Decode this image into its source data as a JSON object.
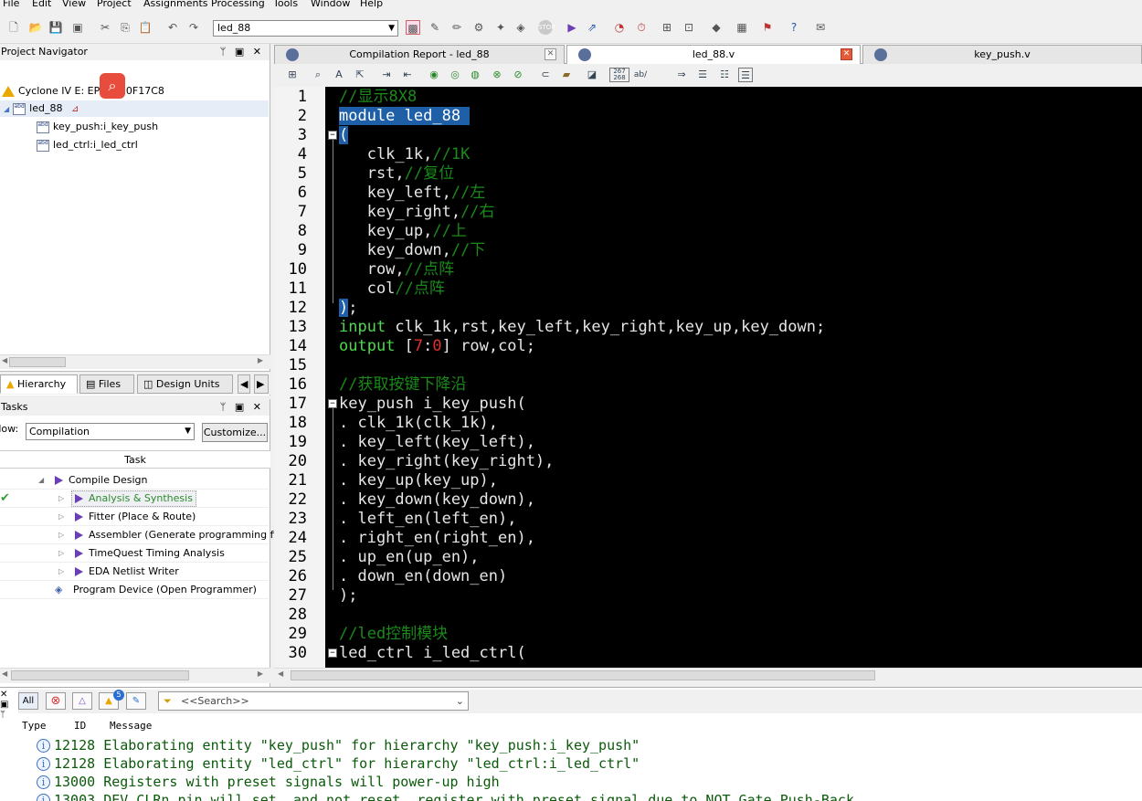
{
  "menu": [
    "File",
    "Edit",
    "View",
    "Project",
    "Assignments",
    "Processing",
    "Tools",
    "Window",
    "Help"
  ],
  "toolbar": {
    "project_combo": "led_88"
  },
  "navigator": {
    "title": "Project Navigator",
    "device": "Cyclone IV E: EP4CE10F17C8",
    "top_entity": "led_88",
    "children": [
      "key_push:i_key_push",
      "led_ctrl:i_led_ctrl"
    ],
    "tabs": [
      "Hierarchy",
      "Files",
      "Design Units"
    ]
  },
  "tasks": {
    "title": "Tasks",
    "flow_label": "Flow:",
    "flow_value": "Compilation",
    "customize_label": "Customize...",
    "column_header": "Task",
    "items": [
      {
        "label": "Compile Design"
      },
      {
        "label": "Analysis & Synthesis",
        "status": "done"
      },
      {
        "label": "Fitter (Place & Route)"
      },
      {
        "label": "Assembler (Generate programming files)"
      },
      {
        "label": "TimeQuest Timing Analysis"
      },
      {
        "label": "EDA Netlist Writer"
      },
      {
        "label": "Program Device (Open Programmer)"
      }
    ]
  },
  "editor": {
    "tabs": [
      "Compilation Report - led_88",
      "led_88.v",
      "key_push.v"
    ],
    "active_tab": "led_88.v",
    "lines": [
      {
        "n": "1",
        "segs": [
          {
            "t": "//显示8X8",
            "c": "cmt"
          }
        ]
      },
      {
        "n": "2",
        "segs": [
          {
            "t": "module led_88 ",
            "c": "selhl"
          }
        ]
      },
      {
        "n": "3",
        "segs": [
          {
            "t": "(",
            "c": "selhl"
          }
        ]
      },
      {
        "n": "4",
        "segs": [
          {
            "t": "   clk_1k,"
          },
          {
            "t": "//1K",
            "c": "cmt"
          }
        ]
      },
      {
        "n": "5",
        "segs": [
          {
            "t": "   rst,"
          },
          {
            "t": "//复位",
            "c": "cmt"
          }
        ]
      },
      {
        "n": "6",
        "segs": [
          {
            "t": "   key_left,"
          },
          {
            "t": "//左",
            "c": "cmt"
          }
        ]
      },
      {
        "n": "7",
        "segs": [
          {
            "t": "   key_right,"
          },
          {
            "t": "//右",
            "c": "cmt"
          }
        ]
      },
      {
        "n": "8",
        "segs": [
          {
            "t": "   key_up,"
          },
          {
            "t": "//上",
            "c": "cmt"
          }
        ]
      },
      {
        "n": "9",
        "segs": [
          {
            "t": "   key_down,"
          },
          {
            "t": "//下",
            "c": "cmt"
          }
        ]
      },
      {
        "n": "10",
        "segs": [
          {
            "t": "   row,"
          },
          {
            "t": "//点阵",
            "c": "cmt"
          }
        ]
      },
      {
        "n": "11",
        "segs": [
          {
            "t": "   col"
          },
          {
            "t": "//点阵",
            "c": "cmt"
          }
        ]
      },
      {
        "n": "12",
        "segs": [
          {
            "t": ")",
            "c": "selhl"
          },
          {
            "t": ";"
          }
        ]
      },
      {
        "n": "13",
        "segs": [
          {
            "t": "input",
            "c": "kw"
          },
          {
            "t": " clk_1k,rst,key_left,key_right,key_up,key_down;"
          }
        ]
      },
      {
        "n": "14",
        "segs": [
          {
            "t": "output",
            "c": "kw"
          },
          {
            "t": " ["
          },
          {
            "t": "7",
            "c": "num"
          },
          {
            "t": ":"
          },
          {
            "t": "0",
            "c": "num"
          },
          {
            "t": "] row,col;"
          }
        ]
      },
      {
        "n": "15",
        "segs": []
      },
      {
        "n": "16",
        "segs": [
          {
            "t": "//获取按键下降沿",
            "c": "cmt"
          }
        ]
      },
      {
        "n": "17",
        "segs": [
          {
            "t": "key_push i_key_push("
          }
        ]
      },
      {
        "n": "18",
        "segs": [
          {
            "t": ". clk_1k(clk_1k),"
          }
        ]
      },
      {
        "n": "19",
        "segs": [
          {
            "t": ". key_left(key_left),"
          }
        ]
      },
      {
        "n": "20",
        "segs": [
          {
            "t": ". key_right(key_right),"
          }
        ]
      },
      {
        "n": "21",
        "segs": [
          {
            "t": ". key_up(key_up),"
          }
        ]
      },
      {
        "n": "22",
        "segs": [
          {
            "t": ". key_down(key_down),"
          }
        ]
      },
      {
        "n": "23",
        "segs": [
          {
            "t": ". left_en(left_en),"
          }
        ]
      },
      {
        "n": "24",
        "segs": [
          {
            "t": ". right_en(right_en),"
          }
        ]
      },
      {
        "n": "25",
        "segs": [
          {
            "t": ". up_en(up_en),"
          }
        ]
      },
      {
        "n": "26",
        "segs": [
          {
            "t": ". down_en(down_en)"
          }
        ]
      },
      {
        "n": "27",
        "segs": [
          {
            "t": ");"
          }
        ]
      },
      {
        "n": "28",
        "segs": []
      },
      {
        "n": "29",
        "segs": [
          {
            "t": "//led控制模块",
            "c": "cmt"
          }
        ]
      },
      {
        "n": "30",
        "segs": [
          {
            "t": "led_ctrl i_led_ctrl("
          }
        ]
      }
    ]
  },
  "messages": {
    "filter_all": "All",
    "warning_count": "5",
    "search_placeholder": "<<Search>>",
    "columns": [
      "Type",
      "ID",
      "Message"
    ],
    "rows": [
      {
        "id": "12128",
        "text": "Elaborating entity \"key_push\" for hierarchy \"key_push:i_key_push\""
      },
      {
        "id": "12128",
        "text": "Elaborating entity \"led_ctrl\" for hierarchy \"led_ctrl:i_led_ctrl\""
      },
      {
        "id": "13000",
        "text": "Registers with preset signals will power-up high"
      },
      {
        "id": "13003",
        "text": "DEV_CLRn pin will set, and not reset, register with preset signal due to NOT Gate Push-Back"
      }
    ]
  },
  "colors": {
    "accent_red": "#e74c3c",
    "code_bg": "#000000",
    "comment": "#1a8a1a",
    "keyword": "#4ed84e",
    "selection": "#1e5fa8"
  }
}
